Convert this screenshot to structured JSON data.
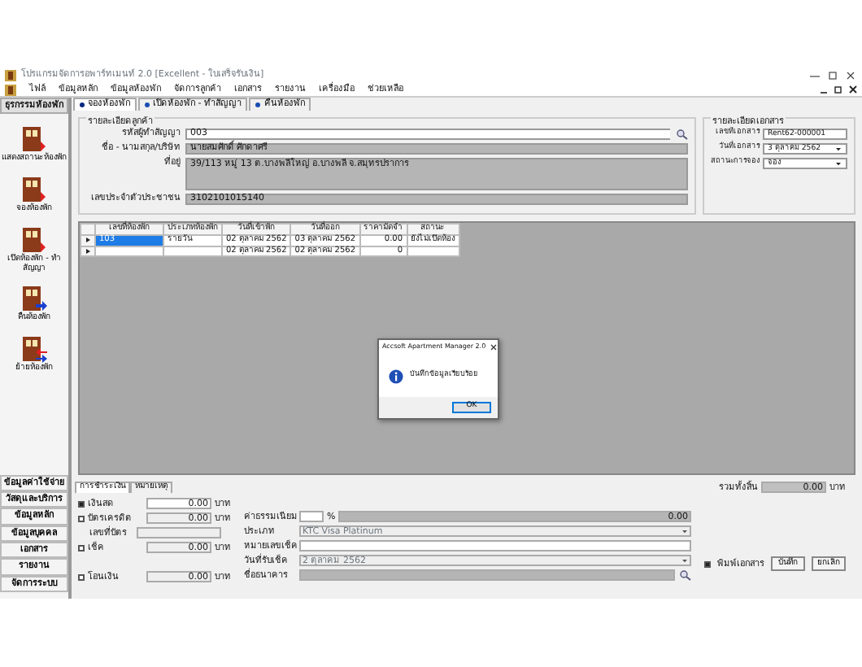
{
  "window": {
    "title": "โปรแกรมจัดการอพาร์ทเมนท์ 2.0 [Excellent - ใบเสร็จรับเงิน]"
  },
  "menu": [
    "ไฟล์",
    "ข้อมูลหลัก",
    "ข้อมูลห้องพัก",
    "จัดการลูกค้า",
    "เอกสาร",
    "รายงาน",
    "เครื่องมือ",
    "ช่วยเหลือ"
  ],
  "sidebar": {
    "header": "ธุรกรรมห้องพัก",
    "items": [
      {
        "label": "แสดงสถานะห้องพัก",
        "kind": "plain"
      },
      {
        "label": "จองห้องพัก",
        "kind": "plain"
      },
      {
        "label": "เปิดห้องพัก - ทำสัญญา",
        "kind": "plain"
      },
      {
        "label": "คืนห้องพัก",
        "kind": "out"
      },
      {
        "label": "ย้ายห้องพัก",
        "kind": "move"
      }
    ],
    "nav": [
      "ข้อมูลค่าใช้จ่าย",
      "วัสดุและบริการ",
      "ข้อมูลหลัก",
      "ข้อมูลบุคคล",
      "เอกสาร",
      "รายงาน",
      "จัดการระบบ"
    ]
  },
  "tabs": [
    {
      "label": "จองห้องพัก",
      "selected": true
    },
    {
      "label": "เปิดห้องพัก - ทำสัญญา",
      "selected": false
    },
    {
      "label": "คืนห้องพัก",
      "selected": false
    }
  ],
  "customer": {
    "title": "รายละเอียดลูกค้า",
    "fields": [
      {
        "label": "รหัสผู้ทำสัญญา",
        "value": "003",
        "kind": "search"
      },
      {
        "label": "ชื่อ - นามสกุล/บริษัท",
        "value": "นายสมศักดิ์  ศักดาศรี",
        "kind": "readonly"
      },
      {
        "label": "ที่อยู่",
        "value": "39/113 หมู่ 13 ต.บางพลีใหญ่ อ.บางพลี จ.สมุทรปราการ",
        "kind": "area"
      },
      {
        "label": "เลขประจำตัวประชาชน",
        "value": "3102101015140",
        "kind": "readonly"
      }
    ]
  },
  "document": {
    "title": "รายละเอียดเอกสาร",
    "fields": [
      {
        "label": "เลขที่เอกสาร",
        "value": "Rent62-000001",
        "kind": "text"
      },
      {
        "label": "วันที่เอกสาร",
        "value": "3   ตุลาคม   2562",
        "kind": "combo"
      },
      {
        "label": "สถานะการจอง",
        "value": "จอง",
        "kind": "combo"
      }
    ]
  },
  "table": {
    "columns": [
      "เลขที่ห้องพัก",
      "ประเภทห้องพัก",
      "วันที่เข้าพัก",
      "วันที่ออก",
      "ราคามัดจำ",
      "สถานะ"
    ],
    "rows": [
      {
        "cells": [
          "103",
          "รายวัน",
          "02 ตุลาคม 2562",
          "03 ตุลาคม 2562",
          "0.00",
          "ยังไม่เปิดห้อง"
        ],
        "selected": true
      },
      {
        "cells": [
          "",
          "",
          "02 ตุลาคม 2562",
          "02 ตุลาคม 2562",
          "0",
          ""
        ],
        "selected": false
      }
    ]
  },
  "dialog": {
    "title": "Accsoft Apartment Manager 2.0",
    "message": "บันทึกข้อมูลเรียบร้อย",
    "button": "OK"
  },
  "bottom_tabs": [
    {
      "label": "การชำระเงิน",
      "selected": true
    },
    {
      "label": "หมายเหตุ",
      "selected": false
    }
  ],
  "payment": {
    "methods": [
      {
        "label": "เงินสด",
        "checked": true,
        "value": "0.00",
        "unit": "บาท"
      },
      {
        "label": "บัตรเครดิต",
        "checked": false,
        "value": "0.00",
        "unit": "บาท"
      },
      {
        "label": "เช็ค",
        "checked": false,
        "value": "0.00",
        "unit": "บาท"
      },
      {
        "label": "โอนเงิน",
        "checked": false,
        "value": "0.00",
        "unit": "บาท"
      }
    ],
    "card_number_label": "เลขที่บัตร",
    "fee_label": "ค่าธรรมเนียม",
    "fee_unit": "%",
    "fee_amount": "0.00",
    "type_label": "ประเภท",
    "type_value": "KTC Visa Platinum",
    "cheque_label": "หมายเลขเช็ค",
    "cheque_date_label": "วันที่รับเช็ค",
    "cheque_date_value": "2   ตุลาคม   2562",
    "bank_label": "ชื่อธนาคาร"
  },
  "total": {
    "label": "รวมทั้งสิ้น",
    "value": "0.00",
    "unit": "บาท"
  },
  "print": {
    "label": "พิมพ์เอกสาร",
    "checked": true
  },
  "buttons": [
    "บันทึก",
    "ยกเลิก"
  ]
}
